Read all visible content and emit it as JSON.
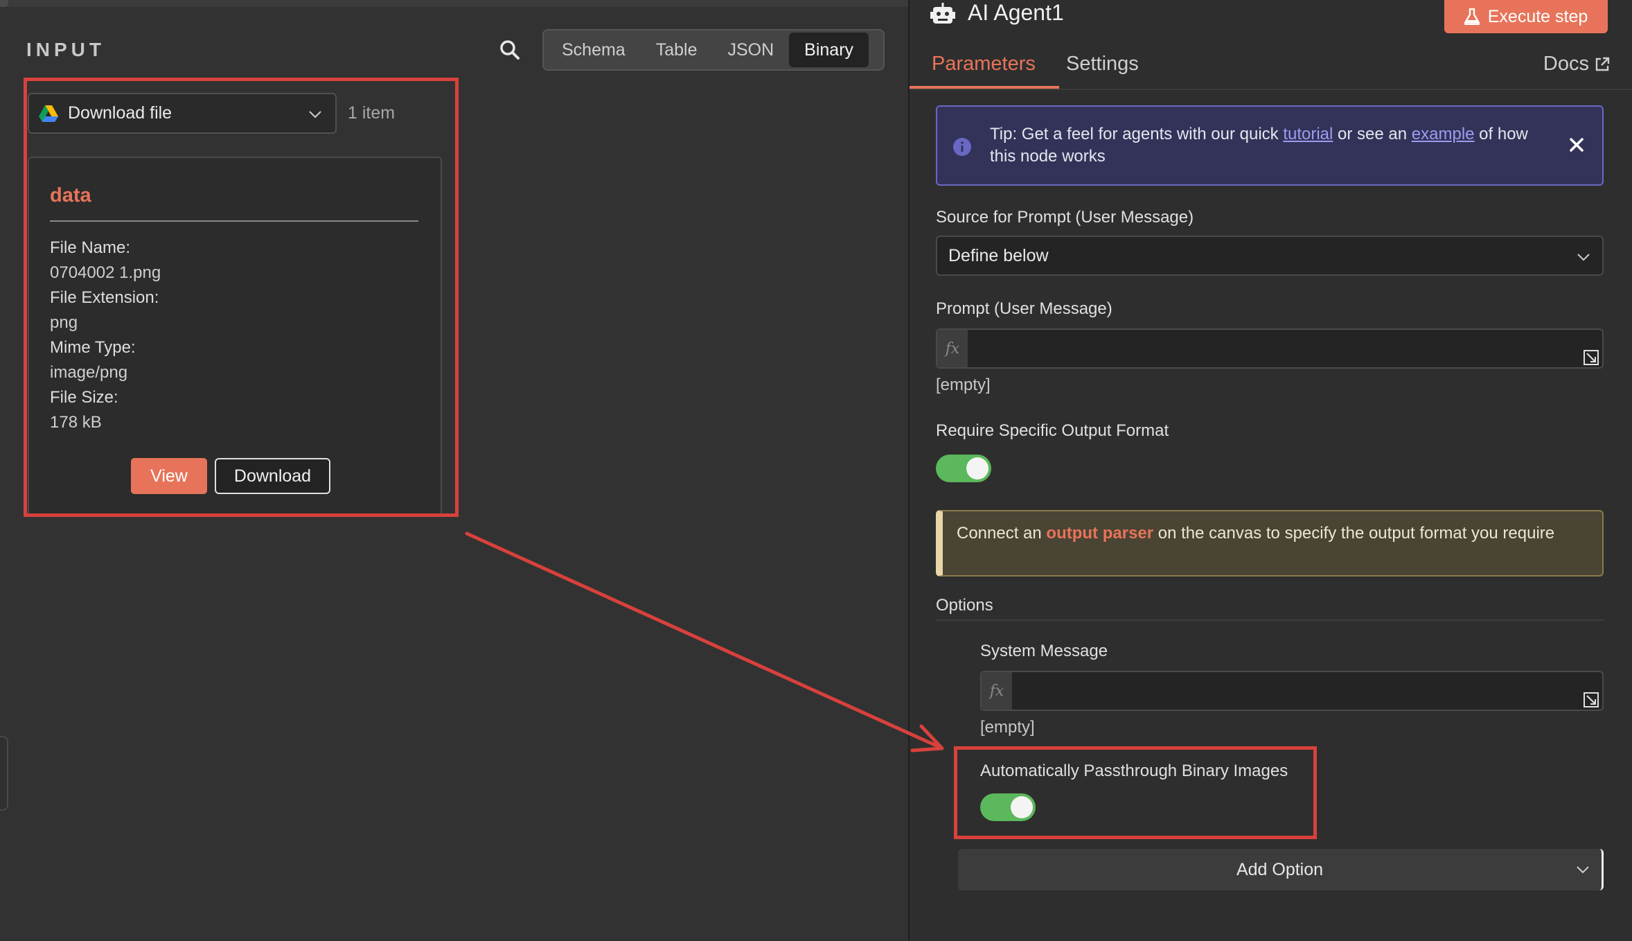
{
  "input": {
    "title": "INPUT",
    "view_tabs": [
      {
        "label": "Schema",
        "active": false
      },
      {
        "label": "Table",
        "active": false
      },
      {
        "label": "JSON",
        "active": false
      },
      {
        "label": "Binary",
        "active": true
      }
    ],
    "node_select": {
      "value": "Download file",
      "icon": "google-drive-icon"
    },
    "item_count": "1 item",
    "binary": {
      "title": "data",
      "fields": [
        {
          "label": "File Name:",
          "value": "0704002 1.png"
        },
        {
          "label": "File Extension:",
          "value": "png"
        },
        {
          "label": "Mime Type:",
          "value": "image/png"
        },
        {
          "label": "File Size:",
          "value": "178 kB"
        }
      ],
      "view_label": "View",
      "download_label": "Download"
    }
  },
  "node": {
    "title": "AI Agent1",
    "execute_label": "Execute step",
    "tabs": [
      {
        "label": "Parameters",
        "active": true
      },
      {
        "label": "Settings",
        "active": false
      }
    ],
    "docs_label": "Docs"
  },
  "tip": {
    "prefix": "Tip: Get a feel for agents with our quick ",
    "link1": "tutorial",
    "middle": " or see an ",
    "link2": "example",
    "suffix": " of how this node works"
  },
  "params": {
    "source_label": "Source for Prompt (User Message)",
    "source_value": "Define below",
    "prompt_label": "Prompt (User Message)",
    "prompt_empty": "[empty]",
    "require_format_label": "Require Specific Output Format",
    "require_format_on": true,
    "notice": {
      "prefix": "Connect an ",
      "highlight": "output parser",
      "suffix": " on the canvas to specify the output format you require"
    },
    "options_label": "Options",
    "system_message_label": "System Message",
    "system_message_empty": "[empty]",
    "passthrough_label": "Automatically Passthrough Binary Images",
    "passthrough_on": true,
    "add_option_label": "Add Option"
  },
  "colors": {
    "accent": "#e7745a",
    "annotation_red": "#d8413c",
    "toggle_on": "#5cb85c",
    "tip_border": "#6a68c4"
  }
}
